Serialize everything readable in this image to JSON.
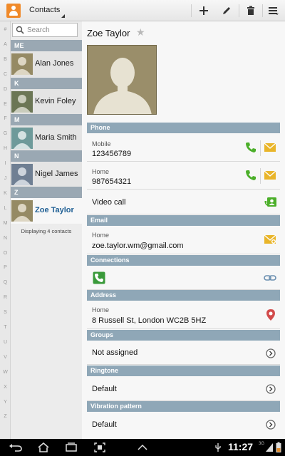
{
  "app": {
    "title": "Contacts"
  },
  "index_letters": [
    "#",
    "A",
    "B",
    "C",
    "D",
    "E",
    "F",
    "G",
    "H",
    "I",
    "J",
    "K",
    "L",
    "M",
    "N",
    "O",
    "P",
    "Q",
    "R",
    "S",
    "T",
    "U",
    "V",
    "W",
    "X",
    "Y",
    "Z"
  ],
  "search": {
    "placeholder": "Search"
  },
  "sections": [
    {
      "letter": "ME",
      "contacts": [
        {
          "name": "Alan Jones"
        }
      ]
    },
    {
      "letter": "K",
      "contacts": [
        {
          "name": "Kevin Foley"
        }
      ]
    },
    {
      "letter": "M",
      "contacts": [
        {
          "name": "Maria Smith"
        }
      ]
    },
    {
      "letter": "N",
      "contacts": [
        {
          "name": "Nigel James"
        }
      ]
    },
    {
      "letter": "Z",
      "contacts": [
        {
          "name": "Zoe Taylor"
        }
      ]
    }
  ],
  "list_footer": "Displaying 4 contacts",
  "detail": {
    "name": "Zoe Taylor",
    "phone": {
      "header": "Phone",
      "mobile_label": "Mobile",
      "mobile_value": "123456789",
      "home_label": "Home",
      "home_value": "987654321",
      "video_call": "Video call"
    },
    "email": {
      "header": "Email",
      "label": "Home",
      "value": "zoe.taylor.wm@gmail.com"
    },
    "connections": {
      "header": "Connections"
    },
    "address": {
      "header": "Address",
      "label": "Home",
      "value": "8 Russell St, London WC2B 5HZ"
    },
    "groups": {
      "header": "Groups",
      "value": "Not assigned"
    },
    "ringtone": {
      "header": "Ringtone",
      "value": "Default"
    },
    "vibration": {
      "header": "Vibration pattern",
      "value": "Default"
    }
  },
  "status": {
    "time": "11:27",
    "network": "3G"
  },
  "colors": {
    "accent": "#f08a2a",
    "header_blue": "#8fa7b7",
    "call_green": "#4caf2a",
    "msg_yellow": "#e9b52a",
    "selected_name": "#1f5f94"
  }
}
